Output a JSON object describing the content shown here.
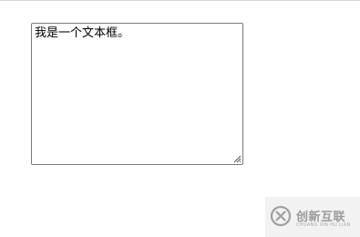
{
  "textarea": {
    "value": "我是一个文本框。"
  },
  "watermark": {
    "logo_icon": "circle-x-logo-icon",
    "brand_cn": "创新互联",
    "brand_en": "CHUANG XIN HU LIAN",
    "color": "#9a9a9a"
  },
  "colors": {
    "page_background": "#ffffff",
    "textarea_border": "#7a7a7a",
    "watermark_background": "#f2f2f2"
  }
}
